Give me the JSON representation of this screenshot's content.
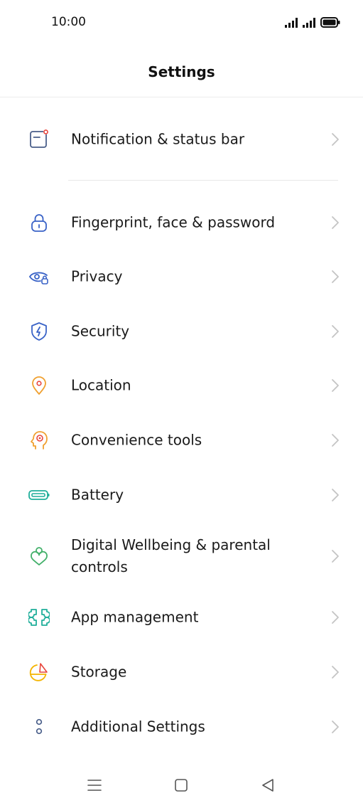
{
  "status_bar": {
    "time": "10:00"
  },
  "header": {
    "title": "Settings"
  },
  "settings": [
    {
      "id": "notification",
      "label": "Notification & status bar",
      "icon": "notification-panel-icon"
    },
    {
      "id": "fingerprint",
      "label": "Fingerprint, face & password",
      "icon": "lock-icon"
    },
    {
      "id": "privacy",
      "label": "Privacy",
      "icon": "privacy-eye-icon"
    },
    {
      "id": "security",
      "label": "Security",
      "icon": "shield-icon"
    },
    {
      "id": "location",
      "label": "Location",
      "icon": "location-pin-icon"
    },
    {
      "id": "convenience",
      "label": "Convenience tools",
      "icon": "convenience-head-icon"
    },
    {
      "id": "battery",
      "label": "Battery",
      "icon": "battery-icon"
    },
    {
      "id": "wellbeing",
      "label": "Digital Wellbeing & parental controls",
      "icon": "wellbeing-heart-icon"
    },
    {
      "id": "apps",
      "label": "App management",
      "icon": "app-grid-icon"
    },
    {
      "id": "storage",
      "label": "Storage",
      "icon": "storage-pie-icon"
    },
    {
      "id": "additional",
      "label": "Additional Settings",
      "icon": "more-dots-icon"
    }
  ],
  "colors": {
    "notification": "#4a5f8a",
    "fingerprint": "#3a63c7",
    "privacy": "#3a63c7",
    "security": "#3a63c7",
    "location": "#f0a030",
    "convenience": "#f0a030",
    "battery": "#1fae9a",
    "wellbeing": "#43b06a",
    "apps": "#1fae9a",
    "storage": "#f4b400",
    "storage_accent": "#e8453c",
    "additional": "#4a5f8a",
    "notification_dot": "#e8453c",
    "chevron": "#c4c4c4"
  }
}
